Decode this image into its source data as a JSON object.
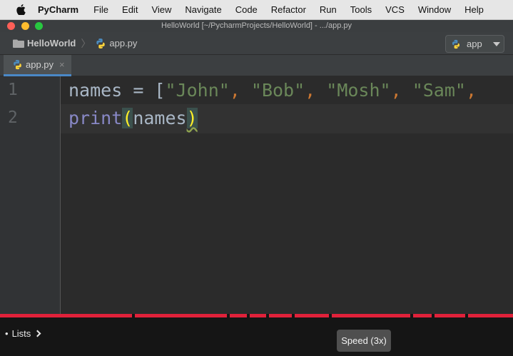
{
  "menubar": {
    "app_name": "PyCharm",
    "items": [
      "File",
      "Edit",
      "View",
      "Navigate",
      "Code",
      "Refactor",
      "Run",
      "Tools",
      "VCS",
      "Window",
      "Help"
    ]
  },
  "window": {
    "title": "HelloWorld [~/PycharmProjects/HelloWorld] - .../app.py"
  },
  "navbar": {
    "project": "HelloWorld",
    "file": "app.py",
    "run_config": "app"
  },
  "tabs": [
    {
      "label": "app.py",
      "close": "×"
    }
  ],
  "editor": {
    "line_numbers": [
      "1",
      "2"
    ],
    "line1": {
      "var": "names",
      "eq": " = ",
      "open": "[",
      "s1": "\"John\"",
      "c1": ", ",
      "s2": "\"Bob\"",
      "c2": ", ",
      "s3": "\"Mosh\"",
      "c3": ", ",
      "s4": "\"Sam\"",
      "c4": ","
    },
    "line2": {
      "func": "print",
      "open": "(",
      "arg": "names",
      "close": ")"
    }
  },
  "video": {
    "chapter": "Lists",
    "chapter_prefix": "•",
    "speed_tooltip": "Speed (3x)",
    "progress_color": "#e0213a"
  },
  "colors": {
    "string": "#6a8759",
    "punctuation": "#cc7832",
    "builtin": "#8888c6",
    "identifier": "#a9b7c6"
  }
}
